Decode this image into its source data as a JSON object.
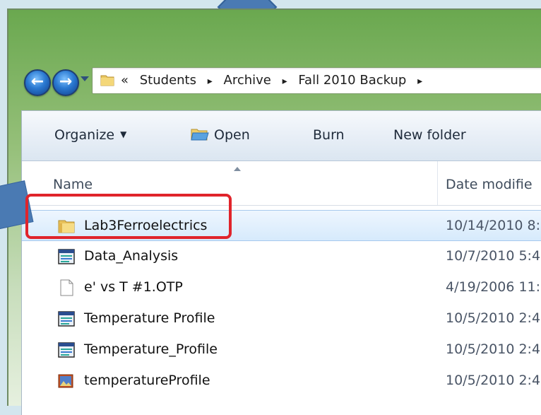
{
  "address": {
    "chevrons": "«",
    "crumbs": [
      "Students",
      "Archive",
      "Fall 2010 Backup"
    ],
    "separator": "▸"
  },
  "toolbar": {
    "organize": "Organize",
    "open": "Open",
    "burn": "Burn",
    "new_folder": "New folder"
  },
  "columns": {
    "name": "Name",
    "date_modified": "Date modifie"
  },
  "files": [
    {
      "name": "Lab3Ferroelectrics",
      "date": "10/14/2010 8:",
      "icon": "folder-icon",
      "selected": true
    },
    {
      "name": "Data_Analysis",
      "date": "10/7/2010 5:4",
      "icon": "app-window-icon",
      "selected": false
    },
    {
      "name": "e' vs T #1.OTP",
      "date": "4/19/2006 11:",
      "icon": "blank-file-icon",
      "selected": false
    },
    {
      "name": "Temperature Profile",
      "date": "10/5/2010 2:4",
      "icon": "app-window-icon",
      "selected": false
    },
    {
      "name": "Temperature_Profile",
      "date": "10/5/2010 2:4",
      "icon": "app-window-icon",
      "selected": false
    },
    {
      "name": "temperatureProfile",
      "date": "10/5/2010 2:4",
      "icon": "image-file-icon",
      "selected": false
    }
  ],
  "colors": {
    "highlight": "#e0242b",
    "selection": "#d6eafc",
    "callout_arrow": "#4a7ab3"
  }
}
